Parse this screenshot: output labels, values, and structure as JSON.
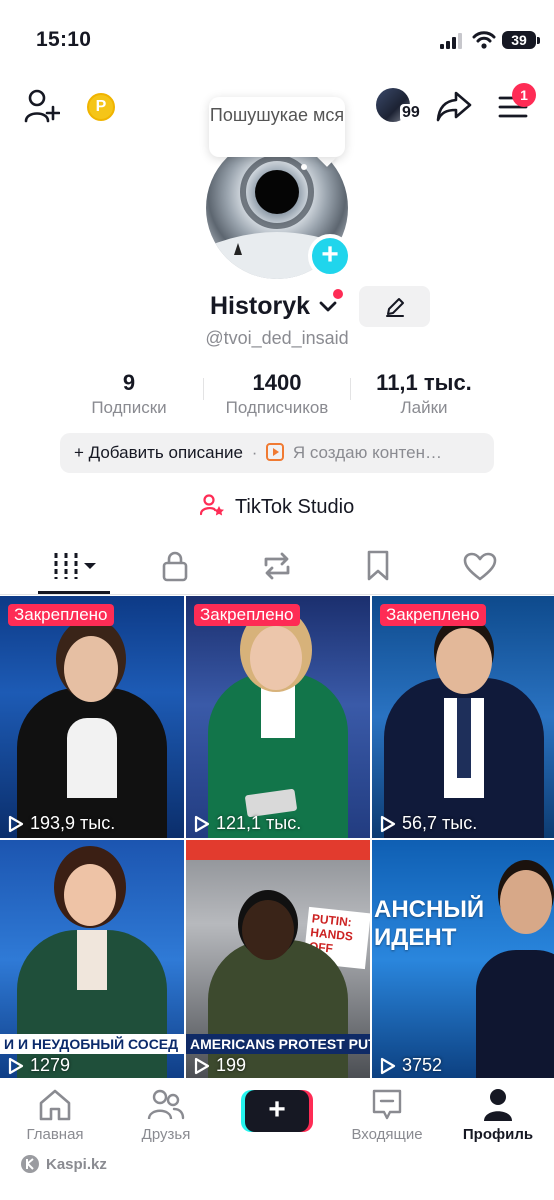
{
  "status": {
    "time": "15:10",
    "battery": "39"
  },
  "header": {
    "coin_label": "P",
    "story_count": "99",
    "notification_count": "1"
  },
  "tooltip": {
    "text": "Пошушукае мся"
  },
  "profile": {
    "display_name": "Historyk",
    "handle": "@tvoi_ded_insaid",
    "stats": [
      {
        "value": "9",
        "label": "Подписки"
      },
      {
        "value": "1400",
        "label": "Подписчиков"
      },
      {
        "value": "11,1 тыс.",
        "label": "Лайки"
      }
    ],
    "add_bio": "+ Добавить описание",
    "bio_separator": "·",
    "creator_label": "Я создаю контен…",
    "studio": "TikTok Studio"
  },
  "videos": [
    {
      "pinned": "Закреплено",
      "views": "193,9 тыс."
    },
    {
      "pinned": "Закреплено",
      "views": "121,1 тыс."
    },
    {
      "pinned": "Закреплено",
      "views": "56,7 тыс."
    },
    {
      "views": "1279",
      "ticker": "И И НЕУДОБНЫЙ СОСЕД"
    },
    {
      "views": "199",
      "ticker": "AMERICANS PROTEST PUTIN",
      "sign": "PUTIN: HANDS OFF"
    },
    {
      "views": "3752",
      "title": "АНСНЫЙ ИДЕНТ"
    }
  ],
  "nav": [
    {
      "label": "Главная",
      "icon": "home-icon"
    },
    {
      "label": "Друзья",
      "icon": "friends-icon"
    },
    {
      "label": "Входящие",
      "icon": "inbox-icon"
    },
    {
      "label": "Профиль",
      "icon": "profile-icon"
    }
  ],
  "watermark": "Kaspi.kz",
  "colors": {
    "accent": "#fe2c55",
    "cyan": "#20d5ec",
    "text": "#161823",
    "muted": "#8a8b91"
  }
}
